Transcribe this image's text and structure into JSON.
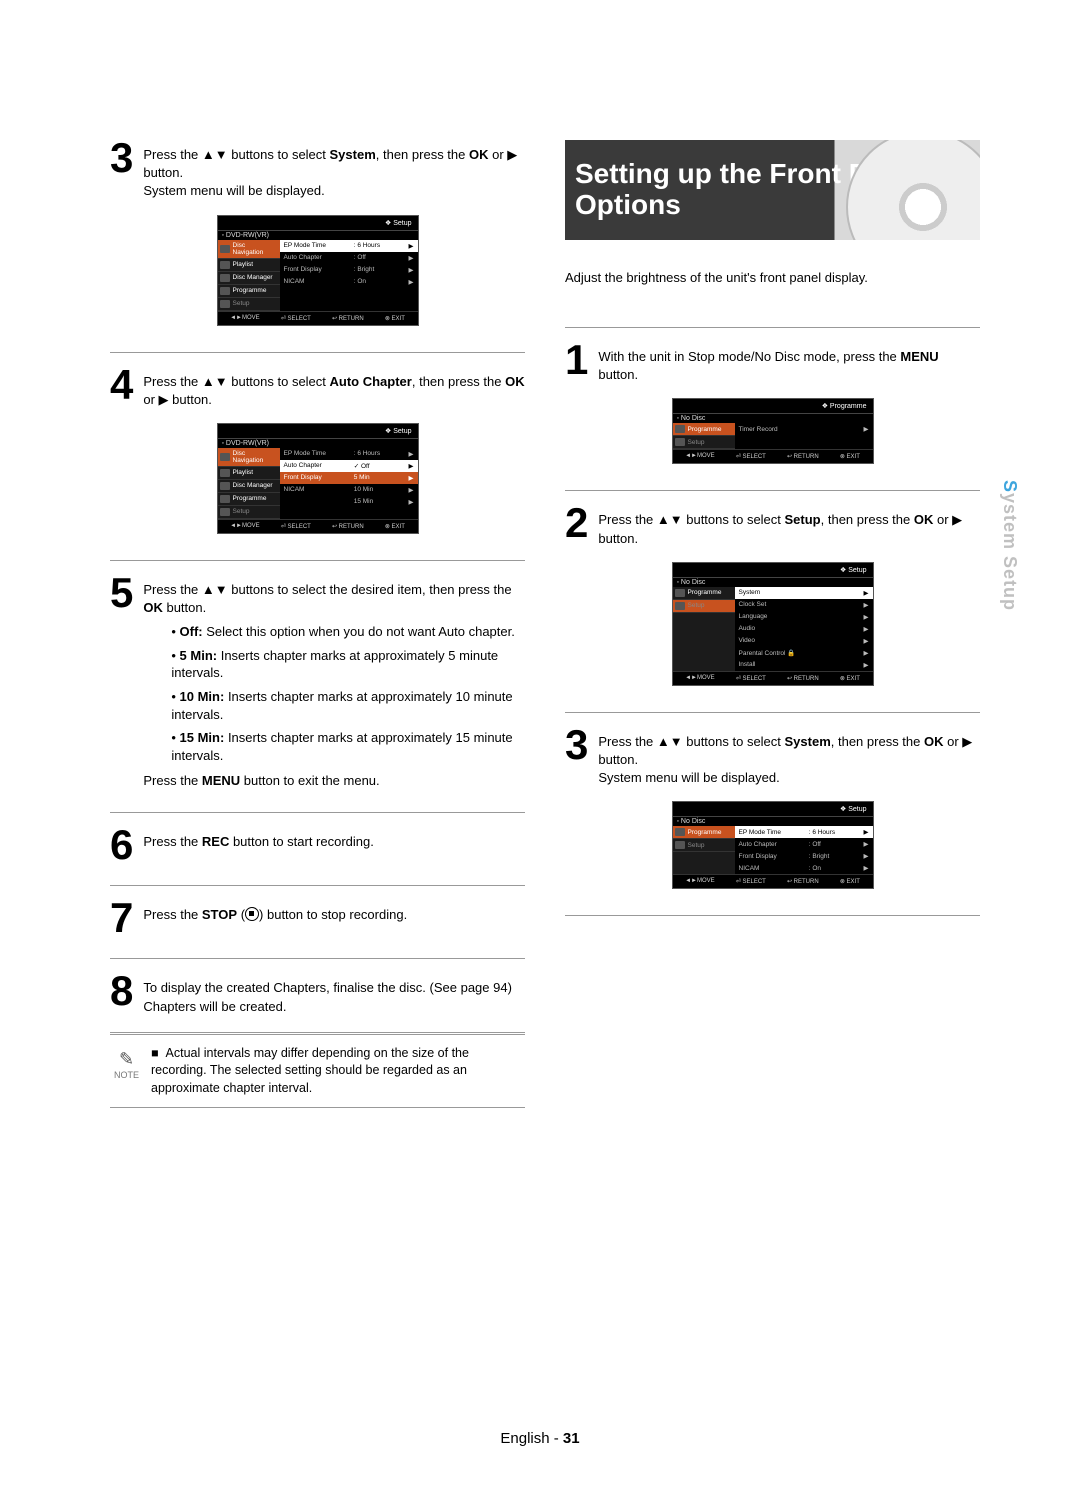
{
  "page": {
    "language": "English",
    "number": "31",
    "sidetab_prefix": "S",
    "sidetab_rest": "ystem Setup"
  },
  "left": {
    "step3": {
      "num": "3",
      "text_a": "Press the ▲▼ buttons to select ",
      "bold_a": "System",
      "text_b": ", then press the ",
      "bold_b": "OK",
      "text_c": " or ▶ button.",
      "line2": "System menu will be displayed."
    },
    "menu3": {
      "header": "❖  Setup",
      "disc": "DVD-RW(VR)",
      "side": [
        {
          "label": "Disc Navigation",
          "sel": true
        },
        {
          "label": "Playlist"
        },
        {
          "label": "Disc Manager"
        },
        {
          "label": "Programme"
        },
        {
          "label": "Setup",
          "dim": true
        }
      ],
      "rows": [
        {
          "k": "EP Mode Time",
          "v": ": 6 Hours",
          "hl": "hl"
        },
        {
          "k": "Auto Chapter",
          "v": ": Off"
        },
        {
          "k": "Front Display",
          "v": ": Bright"
        },
        {
          "k": "NICAM",
          "v": ": On"
        }
      ],
      "footer": [
        "◄►MOVE",
        "⏎ SELECT",
        "↩ RETURN",
        "⊗ EXIT"
      ]
    },
    "step4": {
      "num": "4",
      "text_a": "Press the ▲▼ buttons to select ",
      "bold_a": "Auto Chapter",
      "text_b": ", then press the ",
      "bold_b": "OK",
      "text_c": " or ▶ button."
    },
    "menu4": {
      "header": "❖  Setup",
      "disc": "DVD-RW(VR)",
      "side": [
        {
          "label": "Disc Navigation",
          "sel": true
        },
        {
          "label": "Playlist"
        },
        {
          "label": "Disc Manager"
        },
        {
          "label": "Programme"
        },
        {
          "label": "Setup",
          "dim": true
        }
      ],
      "rows": [
        {
          "k": "EP Mode Time",
          "v": ": 6 Hours"
        },
        {
          "k": "Auto Chapter",
          "v": "✓ Off",
          "hl": "hl"
        },
        {
          "k": "Front Display",
          "v": "5 Min",
          "hl": "hl-orange"
        },
        {
          "k": "NICAM",
          "v": "10 Min"
        },
        {
          "k": "",
          "v": "15 Min"
        }
      ],
      "footer": [
        "◄►MOVE",
        "⏎ SELECT",
        "↩ RETURN",
        "⊗ EXIT"
      ]
    },
    "step5": {
      "num": "5",
      "text_a": "Press the ▲▼ buttons to select the desired item, then press the ",
      "bold_a": "OK",
      "text_b": " button.",
      "opts": [
        {
          "b": "Off:",
          "t": " Select this option when you do not want Auto chapter."
        },
        {
          "b": "5 Min:",
          "t": " Inserts chapter marks at approximately 5 minute intervals."
        },
        {
          "b": "10 Min:",
          "t": " Inserts chapter marks at approximately 10 minute intervals."
        },
        {
          "b": "15 Min:",
          "t": " Inserts chapter marks at approximately 15 minute intervals."
        }
      ],
      "after_a": "Press the ",
      "after_b": "MENU",
      "after_c": " button to exit the menu."
    },
    "step6": {
      "num": "6",
      "text_a": "Press the ",
      "bold_a": "REC",
      "text_b": " button to start recording."
    },
    "step7": {
      "num": "7",
      "text_a": "Press the ",
      "bold_a": "STOP",
      "text_b": " button to stop recording."
    },
    "step8": {
      "num": "8",
      "line1": "To display the created Chapters, finalise the disc. (See page 94)",
      "line2": "Chapters will be created."
    },
    "note": {
      "label": "NOTE",
      "bullet": "■",
      "text": "Actual intervals may differ depending on the size of the recording. The selected setting should be regarded as an approximate chapter interval."
    }
  },
  "right": {
    "title": "Setting up the Front Display Options",
    "intro": "Adjust the brightness of the unit's front panel display.",
    "step1": {
      "num": "1",
      "text_a": "With the unit in Stop mode/No Disc mode, press the ",
      "bold_a": "MENU",
      "text_b": " button."
    },
    "menu1": {
      "header": "❖  Programme",
      "disc": "No Disc",
      "side": [
        {
          "label": "Programme",
          "sel": true
        },
        {
          "label": "Setup",
          "dim": true
        }
      ],
      "rows": [
        {
          "k": "Timer Record",
          "v": "",
          "hl": ""
        }
      ],
      "footer": [
        "◄►MOVE",
        "⏎ SELECT",
        "↩ RETURN",
        "⊗ EXIT"
      ]
    },
    "step2": {
      "num": "2",
      "text_a": "Press the ▲▼ buttons to select ",
      "bold_a": "Setup",
      "text_b": ", then press the ",
      "bold_b": "OK",
      "text_c": " or ▶ button."
    },
    "menu2": {
      "header": "❖  Setup",
      "disc": "No Disc",
      "side": [
        {
          "label": "Programme"
        },
        {
          "label": "Setup",
          "sel": true,
          "dim": true
        }
      ],
      "rows": [
        {
          "k": "System",
          "v": "",
          "hl": "hl"
        },
        {
          "k": "Clock Set",
          "v": ""
        },
        {
          "k": "Language",
          "v": ""
        },
        {
          "k": "Audio",
          "v": ""
        },
        {
          "k": "Video",
          "v": ""
        },
        {
          "k": "Parental Control 🔒",
          "v": ""
        },
        {
          "k": "Install",
          "v": ""
        }
      ],
      "footer": [
        "◄►MOVE",
        "⏎ SELECT",
        "↩ RETURN",
        "⊗ EXIT"
      ]
    },
    "step3": {
      "num": "3",
      "text_a": "Press the ▲▼ buttons to select ",
      "bold_a": "System",
      "text_b": ", then press the ",
      "bold_b": "OK",
      "text_c": " or ▶ button.",
      "line2": "System menu will be displayed."
    },
    "menu3": {
      "header": "❖  Setup",
      "disc": "No Disc",
      "side": [
        {
          "label": "Programme",
          "sel": true
        },
        {
          "label": "Setup",
          "dim": true
        }
      ],
      "rows": [
        {
          "k": "EP Mode Time",
          "v": ": 6 Hours",
          "hl": "hl"
        },
        {
          "k": "Auto Chapter",
          "v": ": Off"
        },
        {
          "k": "Front Display",
          "v": ": Bright"
        },
        {
          "k": "NICAM",
          "v": ": On"
        }
      ],
      "footer": [
        "◄►MOVE",
        "⏎ SELECT",
        "↩ RETURN",
        "⊗ EXIT"
      ]
    }
  }
}
